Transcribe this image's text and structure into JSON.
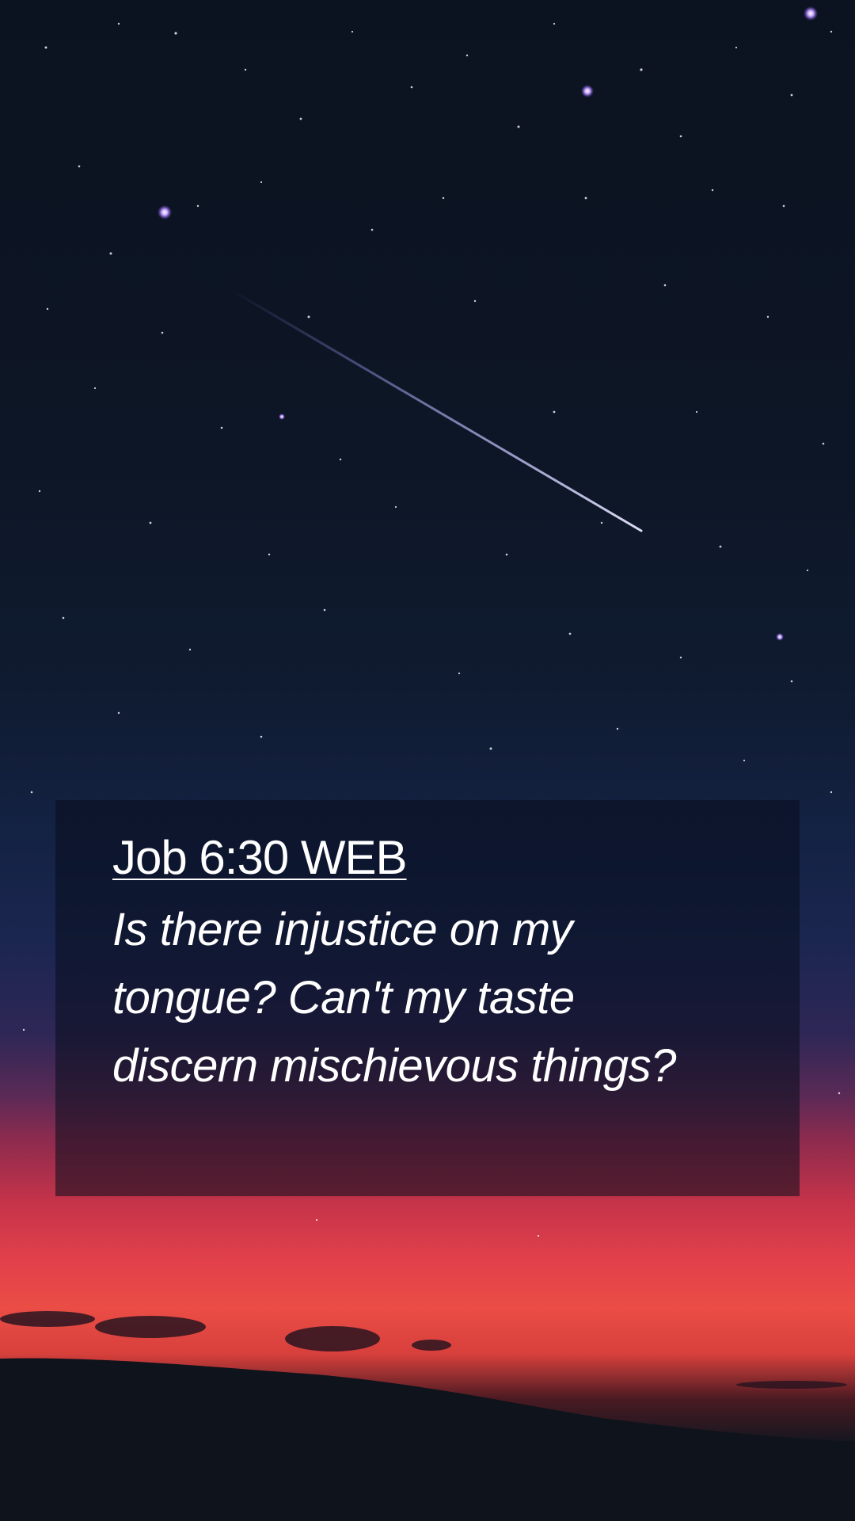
{
  "verse": {
    "reference": "Job 6:30 WEB",
    "text": "Is there injustice on my tongue? Can't my taste discern mischievous things?"
  },
  "background": {
    "description_icon": "night-sky-shooting-star",
    "colors": {
      "sky_top": "#0c1320",
      "sky_mid": "#142244",
      "horizon_red": "#e2414a",
      "ground": "#0d1119",
      "card_overlay": "#080c1c"
    }
  }
}
